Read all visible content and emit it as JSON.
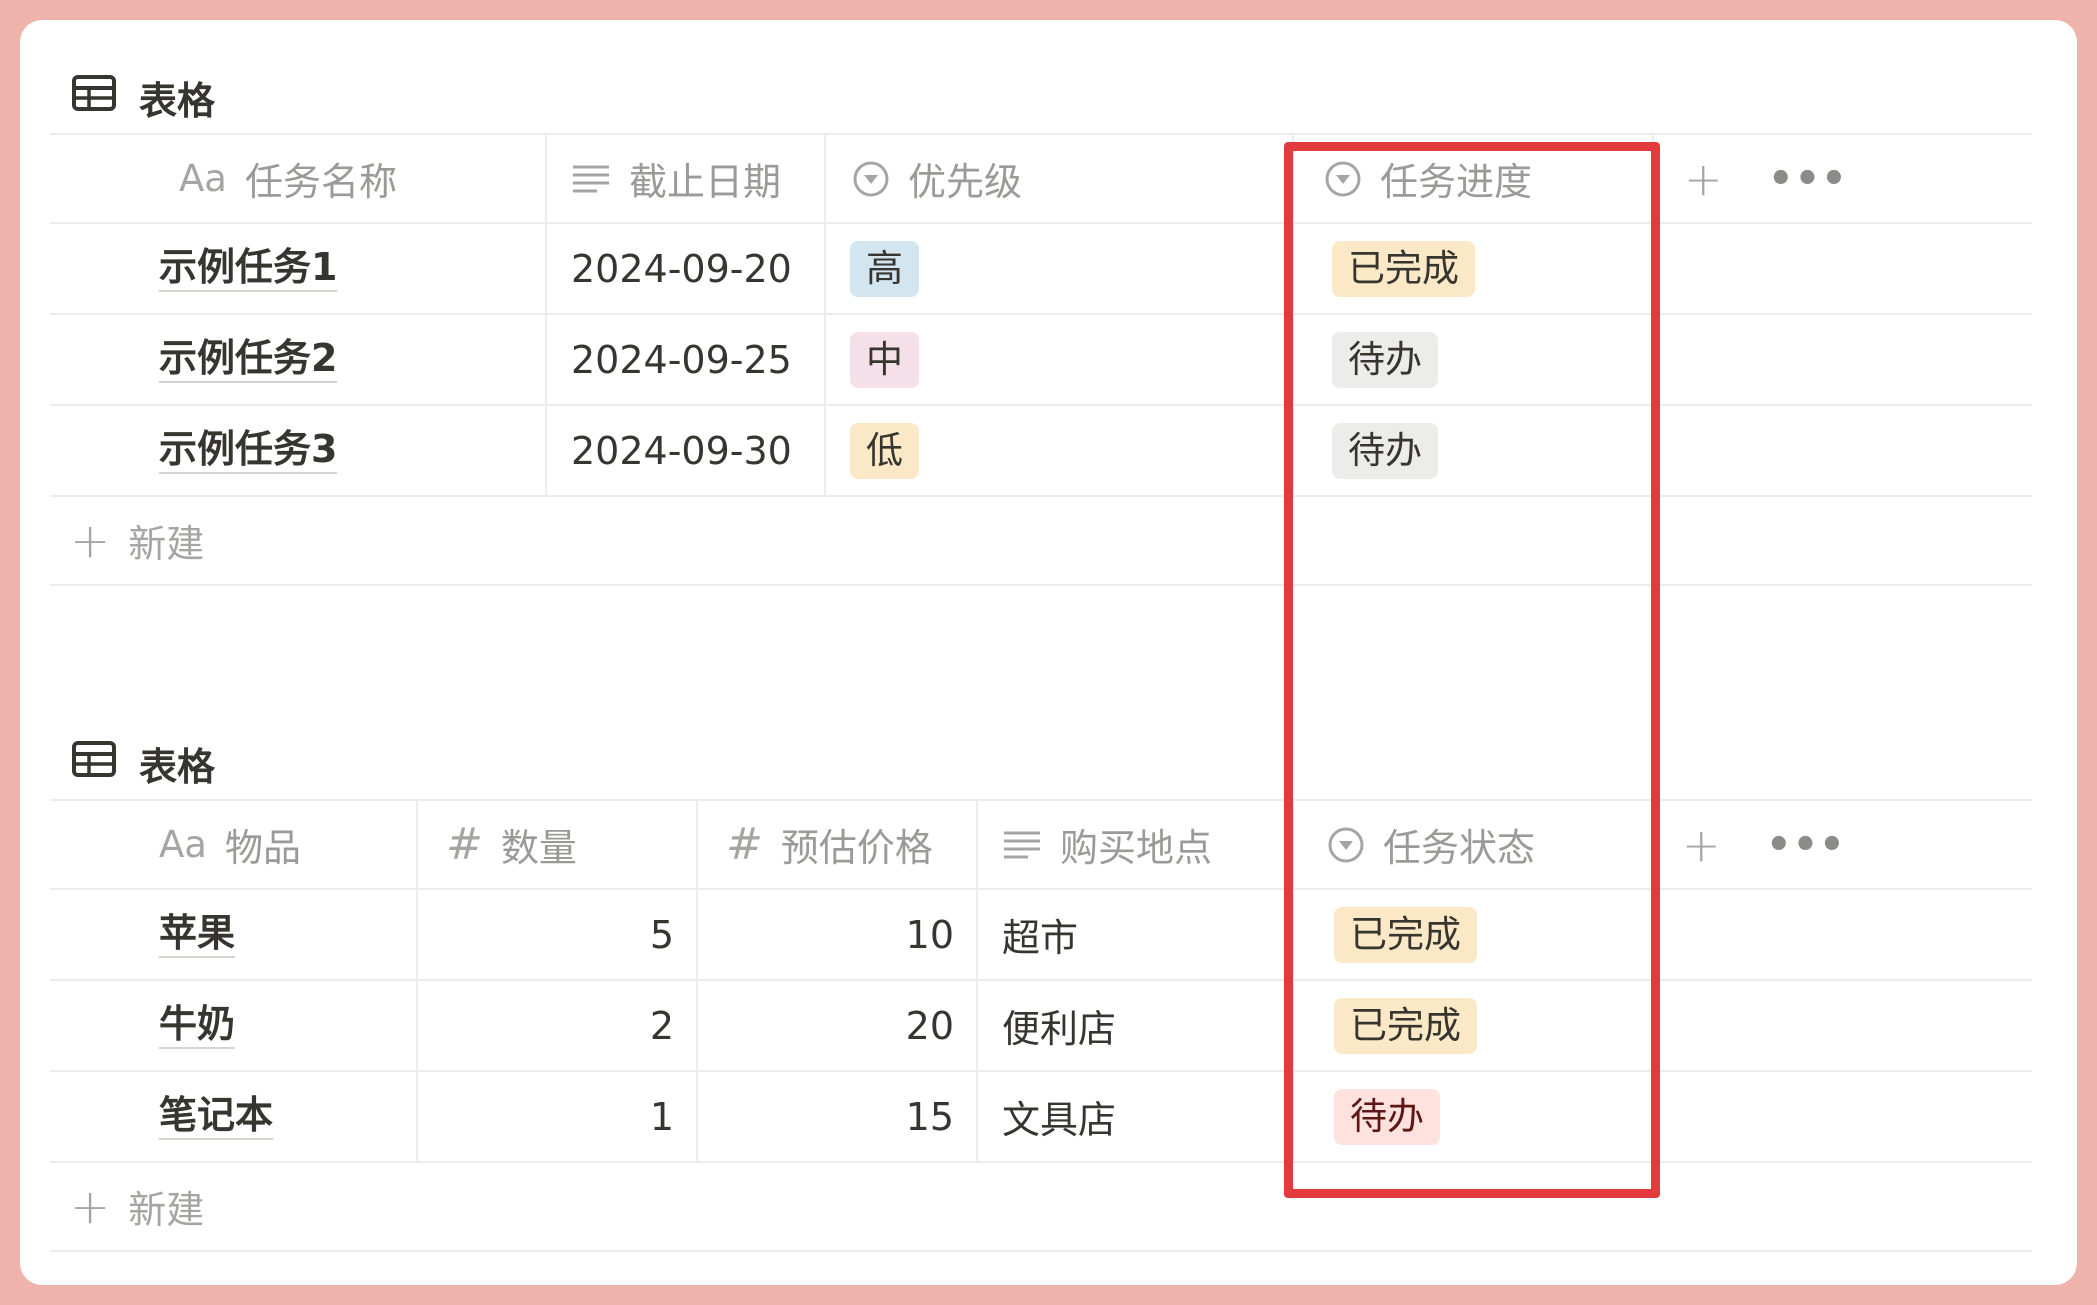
{
  "colors": {
    "background": "#eeb3ab",
    "highlight_border": "#e33b3d",
    "tag_blue": "#d3e5ef",
    "tag_pink": "#f5e0e9",
    "tag_yellow": "#fae8c6",
    "tag_gray": "#ececea",
    "tag_red": "#ffe2dd"
  },
  "table1": {
    "title": "表格",
    "headers": {
      "name": "任务名称",
      "name_prefix": "Aa",
      "deadline": "截止日期",
      "priority": "优先级",
      "progress": "任务进度"
    },
    "rows": [
      {
        "name": "示例任务1",
        "deadline": "2024-09-20",
        "priority": "高",
        "priority_color": "#d3e5ef",
        "progress": "已完成",
        "progress_color": "#fae8c6"
      },
      {
        "name": "示例任务2",
        "deadline": "2024-09-25",
        "priority": "中",
        "priority_color": "#f5e0e9",
        "progress": "待办",
        "progress_color": "#ececea"
      },
      {
        "name": "示例任务3",
        "deadline": "2024-09-30",
        "priority": "低",
        "priority_color": "#fae8c6",
        "progress": "待办",
        "progress_color": "#ececea"
      }
    ],
    "new_label": "新建",
    "add_column": "+",
    "more": "•••"
  },
  "table2": {
    "title": "表格",
    "headers": {
      "item": "物品",
      "item_prefix": "Aa",
      "quantity": "数量",
      "price": "预估价格",
      "place": "购买地点",
      "status": "任务状态",
      "hash": "#"
    },
    "rows": [
      {
        "item": "苹果",
        "quantity": "5",
        "price": "10",
        "place": "超市",
        "status": "已完成",
        "status_color": "#fae8c6"
      },
      {
        "item": "牛奶",
        "quantity": "2",
        "price": "20",
        "place": "便利店",
        "status": "已完成",
        "status_color": "#fae8c6"
      },
      {
        "item": "笔记本",
        "quantity": "1",
        "price": "15",
        "place": "文具店",
        "status": "待办",
        "status_color": "#ffe2dd"
      }
    ],
    "new_label": "新建",
    "add_column": "+",
    "more": "•••"
  }
}
